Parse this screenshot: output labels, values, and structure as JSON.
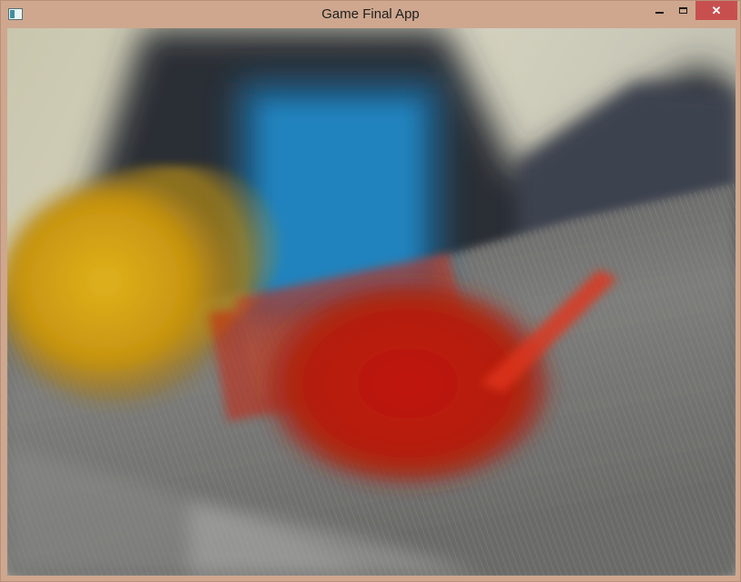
{
  "window": {
    "title": "Game Final App",
    "close_glyph": "✕"
  },
  "icons": {
    "app": "app-window-icon",
    "minimize": "minimize-icon",
    "maximize": "maximize-icon",
    "close": "close-icon"
  },
  "colors": {
    "titlebar": "#cfa78f",
    "close_button": "#c7504f",
    "yellow_ball": "#d09a12",
    "blue_block": "#1f7fb8",
    "red_block": "#c81a08",
    "floor": "#6c6c6a"
  }
}
